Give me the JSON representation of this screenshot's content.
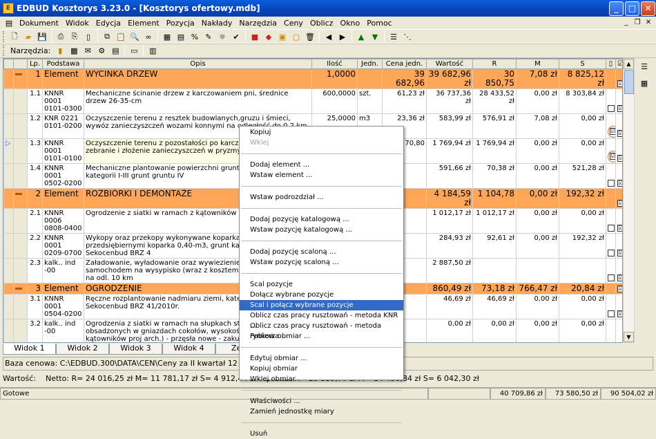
{
  "window": {
    "title": "EDBUD Kosztorys 3.23.0 - [Kosztorys ofertowy.mdb]",
    "icon": "app-icon"
  },
  "menu": [
    "Dokument",
    "Widok",
    "Edycja",
    "Element",
    "Pozycja",
    "Nakłady",
    "Narzędzia",
    "Ceny",
    "Oblicz",
    "Okno",
    "Pomoc"
  ],
  "toolbar2_label": "Narzędzia:",
  "table": {
    "headers": [
      "Lp.",
      "Podstawa",
      "Opis",
      "Ilość",
      "Jedn.",
      "Cena jedn.",
      "Wartość",
      "R",
      "M",
      "S"
    ],
    "rows": [
      {
        "type": "el",
        "lp": "1",
        "podstawa": "Element",
        "opis": "WYCINKA DRZEW",
        "ilosc": "1,0000",
        "jedn": "",
        "cena": "39 682,96",
        "wartosc": "39 682,96 zł",
        "r": "30 850,75",
        "m": "7,08 zł",
        "s": "8 825,12 zł"
      },
      {
        "type": "poz",
        "lp": "1.1",
        "podstawa": "KNNR 0001 0101-0300",
        "opis": "Mechaniczne ścinanie drzew z karczowaniem pni, średnice drzew 26-35-cm",
        "ilosc": "600,0000",
        "jedn": "szt.",
        "cena": "61,23 zł",
        "wartosc": "36 737,36 zł",
        "r": "28 433,52 zł",
        "m": "0,00 zł",
        "s": "8 303,84 zł"
      },
      {
        "type": "poz",
        "lp": "1.2",
        "podstawa": "KNR 0221 0101-0200",
        "opis": "Oczyszczenie terenu z resztek budowlanych,gruzu i śmieci, wywóz zanieczyszczeń wozami konnymi na odległość do 0,2 km",
        "ilosc": "25,0000",
        "jedn": "m3",
        "cena": "23,36 zł",
        "wartosc": "583,99 zł",
        "r": "576,91 zł",
        "m": "7,08 zł",
        "s": "0,00 zł"
      },
      {
        "type": "poz",
        "lp": "1.3",
        "podstawa": "KNNR 0001 0101-0100",
        "opis": "Oczyszczenie terenu z pozostałości po karczowaniu drzew, zebranie i złożenie zanieczyszczeń w pryzmy",
        "ilosc": "25,0000",
        "jedn": "m3",
        "cena": "70,80",
        "wartosc": "1 769,94 zł",
        "r": "1 769,94 zł",
        "m": "0,00 zł",
        "s": "0,00 zł"
      },
      {
        "type": "poz",
        "lp": "1.4",
        "podstawa": "KNNR 0001 0502-0200",
        "opis": "Mechaniczne plantowanie powierzchni gruntu rodzimego kategorii I-III grunt gruntu IV",
        "ilosc": "",
        "jedn": "",
        "cena": "",
        "wartosc": "591,66 zł",
        "r": "70,38 zł",
        "m": "0,00 zł",
        "s": "521,28 zł"
      },
      {
        "type": "el",
        "lp": "2",
        "podstawa": "Element",
        "opis": "ROZBIÓRKI I DEMONTAŻE",
        "ilosc": "",
        "jedn": "",
        "cena": "",
        "wartosc": "4 184,59 zł",
        "r": "1 104,78",
        "m": "0,00 zł",
        "s": "192,32 zł"
      },
      {
        "type": "poz",
        "lp": "2.1",
        "podstawa": "KNNR 0006 0808-0400",
        "opis": " Ogrodzenie z siatki w ramach z kątowników - rozebranie",
        "ilosc": "",
        "jedn": "",
        "cena": "",
        "wartosc": "1 012,17 zł",
        "r": "1 012,17 zł",
        "m": "0,00 zł",
        "s": "0,00 zł"
      },
      {
        "type": "poz",
        "lp": "2.2",
        "podstawa": "KNNR 0001 0209-0700",
        "opis": " Wykopy oraz przekopy wykonywane koparkami przedsiębiernymi koparka 0,40-m3, grunt kategorii IV -Sekocenbud BRZ 4",
        "ilosc": "",
        "jedn": "",
        "cena": "",
        "wartosc": "284,93 zł",
        "r": "92,61 zł",
        "m": "0,00 zł",
        "s": "192,32 zł"
      },
      {
        "type": "poz",
        "lp": "2.3",
        "podstawa": "kalk.. ind -00",
        "opis": "Załadowanie, wyładowanie oraz wywiezienie gruzu samochodem na wysypisko (wraz z kosztem utylizacji), odwóz na odl. 10 km",
        "ilosc": "",
        "jedn": "",
        "cena": "",
        "wartosc": "2 887,50 zł",
        "r": "",
        "m": "",
        "s": ""
      },
      {
        "type": "el",
        "lp": "3",
        "podstawa": "Element",
        "opis": "OGRODZENIE",
        "ilosc": "",
        "jedn": "",
        "cena": "",
        "wartosc": "860,49 zł",
        "r": "73,18 zł",
        "m": "766,47 zł",
        "s": "20,84 zł"
      },
      {
        "type": "poz",
        "lp": "3.1",
        "podstawa": "KNNR 0001 0504-0200",
        "opis": " Ręczne rozplantowanie nadmiaru ziemi, kategoria gruntu I-IV Sekocenbud BRZ 41/2010r.",
        "ilosc": "",
        "jedn": "",
        "cena": "",
        "wartosc": "46,69 zł",
        "r": "46,69 zł",
        "m": "0,00 zł",
        "s": "0,00 zł"
      },
      {
        "type": "poz",
        "lp": "3.2",
        "podstawa": "kalk.. ind -00",
        "opis": "Ogrodzenia z siatki w ramach na słupkach stalowych obsadzonych w gniazdach cokołów, wysokość 1,24-m, słupki z kątowników proj arch.) - przęsła nowe - zakup, dostawa i montaż",
        "ilosc": "",
        "jedn": "",
        "cena": "",
        "wartosc": "0,00 zł",
        "r": "0,00 zł",
        "m": "0,00 zł",
        "s": "0,00 zł"
      },
      {
        "type": "poz",
        "lp": "3.3",
        "podstawa": "KNNR 0006 0113-0100",
        "opis": "Podbudowy z kruszyw łamanych, warstwa dolna, po zagęszczeniu",
        "ilosc": "",
        "jedn": "",
        "cena": "",
        "wartosc": "483,30 zł",
        "r": "13,37 zł",
        "m": "459,88 zł",
        "s": "10,05 zł"
      },
      {
        "type": "poz",
        "lp": "3.4",
        "podstawa": "KNNR 0006",
        "opis": "Podbudowy z kruszyw łamanych, warstwa górna, po zag",
        "ilosc": "",
        "jedn": "",
        "cena": "",
        "wartosc": "330,50 zł",
        "r": "13,12 zł",
        "m": "306,59 zł",
        "s": "10,79 zł"
      }
    ]
  },
  "tabs": [
    "Widok 1",
    "Widok 2",
    "Widok 3",
    "Widok 4",
    "Zesta"
  ],
  "baza": "Baza cenowa:  C:\\EDBUD.300\\DATA\\CEN\\Ceny za II kwartał 12 rok (SEKOCENBUD)",
  "wartosc": {
    "label": "Wartość:",
    "netto": "Netto:  R=  24 016,25 zł      M=  11 781,17 zł      S=   4 912,44 zł",
    "brutto": "Brutto:  R=  29 539,77 zł      M=  14 490,84 zł      S=   6 042,30 zł"
  },
  "status": {
    "text": "Gotowe",
    "v1": "40 709,86 zł",
    "v2": "73 580,50 zł",
    "v3": "90 504,02 zł"
  },
  "context_menu": [
    {
      "label": "Kopiuj"
    },
    {
      "label": "Wklej",
      "disabled": true
    },
    {
      "sep": true
    },
    {
      "label": "Dodaj element ..."
    },
    {
      "label": "Wstaw element ..."
    },
    {
      "sep": true
    },
    {
      "label": "Wstaw podrozdział ..."
    },
    {
      "sep": true
    },
    {
      "label": "Dodaj pozycję katalogową ..."
    },
    {
      "label": "Wstaw pozycję katalogową ..."
    },
    {
      "sep": true
    },
    {
      "label": "Dodaj pozycję scaloną ..."
    },
    {
      "label": "Wstaw pozycję scaloną ..."
    },
    {
      "sep": true
    },
    {
      "label": "Scal pozycje"
    },
    {
      "label": "Dołącz wybrane pozycje"
    },
    {
      "label": "Scal i połącz wybrane pozycje",
      "highlighted": true
    },
    {
      "label": "Oblicz czas pracy rusztowań - metoda KNR ..."
    },
    {
      "label": "Oblicz czas pracy rusztowań - metoda rynkowa ..."
    },
    {
      "label": "Pobierz obmiar ..."
    },
    {
      "sep": true
    },
    {
      "label": "Edytuj obmiar ..."
    },
    {
      "label": "Kopiuj obmiar"
    },
    {
      "label": "Wklej obmiar"
    },
    {
      "sep": true
    },
    {
      "label": "Właściwości ..."
    },
    {
      "label": "Zamień jednostkę miary"
    },
    {
      "sep": true
    },
    {
      "label": "Usuń"
    }
  ],
  "colors": {
    "element_row": "#ffa659",
    "highlight": "#316ac5",
    "titlebar": "#0a5fdc"
  }
}
